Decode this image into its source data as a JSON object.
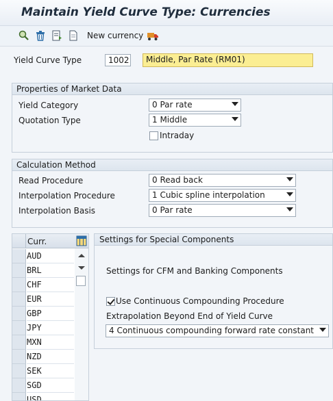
{
  "title": "Maintain Yield Curve Type: Currencies",
  "toolbar": {
    "icons": [
      "find-icon",
      "delete-icon",
      "export-icon",
      "document-icon",
      "transport-icon"
    ],
    "new_currency_label": "New currency"
  },
  "header": {
    "curve_type_label": "Yield Curve Type",
    "curve_type_value": "1002",
    "curve_type_desc": "Middle, Par Rate (RM01)"
  },
  "market": {
    "title": "Properties of Market Data",
    "yield_category_label": "Yield Category",
    "yield_category_value": "0 Par rate",
    "quotation_type_label": "Quotation Type",
    "quotation_type_value": "1 Middle",
    "intraday_label": "Intraday",
    "intraday_checked": false
  },
  "calc": {
    "title": "Calculation Method",
    "read_label": "Read Procedure",
    "read_value": "0 Read back",
    "interp_label": "Interpolation Procedure",
    "interp_value": "1 Cubic spline interpolation",
    "basis_label": "Interpolation Basis",
    "basis_value": "0 Par rate"
  },
  "table": {
    "column_header": "Curr.",
    "rows": [
      "AUD",
      "BRL",
      "CHF",
      "EUR",
      "GBP",
      "JPY",
      "MXN",
      "NZD",
      "SEK",
      "SGD",
      "USD"
    ]
  },
  "special": {
    "title": "Settings for Special Components",
    "subtitle": "Settings for CFM and Banking Components",
    "continuous_label": "Use Continuous Compounding Procedure",
    "continuous_checked": true,
    "extrap_label": "Extrapolation Beyond End of Yield Curve",
    "extrap_value": "4 Continuous compounding forward rate constant"
  },
  "colors": {
    "highlight_field": "#fbee93",
    "panel_bg": "#f2f5f9"
  }
}
